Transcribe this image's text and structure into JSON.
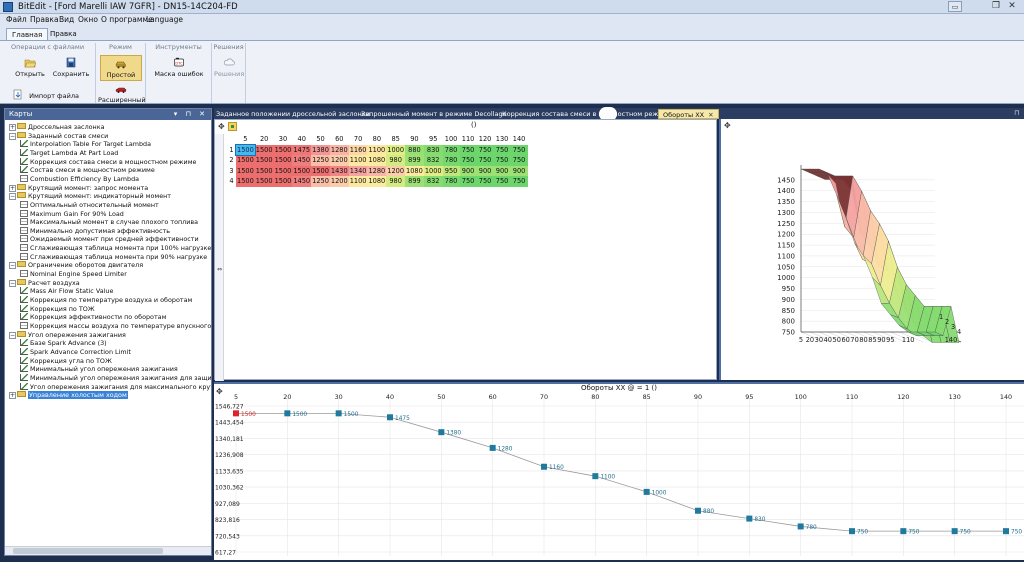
{
  "window": {
    "title": "BitEdit - [Ford Marelli IAW 7GFR] - DN15-14C204-FD",
    "restore_glyph": "❐",
    "close_glyph": "✕",
    "min_glyph": "▭"
  },
  "menu": [
    "Файл",
    "Правка",
    "Вид",
    "Окно",
    "О программе",
    "Language"
  ],
  "ribbon_tabs": [
    {
      "label": "Главная",
      "active": true
    },
    {
      "label": "Правка",
      "active": false
    }
  ],
  "ribbon": {
    "file_group": {
      "label": "Операции с файлами",
      "open": "Открыть",
      "save": "Сохранить",
      "import": "Импорт файла"
    },
    "mode_group": {
      "label": "Режим",
      "simple": "Простой",
      "advanced": "Расширенный"
    },
    "tools_group": {
      "label": "Инструменты",
      "error_mask": "Маска ошибок",
      "dtc_text": "DTC"
    },
    "solutions_group": {
      "label": "Решения",
      "solutions": "Решения"
    }
  },
  "left_panel": {
    "title": "Карты",
    "controls": "▾ ⊓ ✕"
  },
  "tree": [
    {
      "level": 0,
      "type": "folder",
      "label": "Дроссельная заслонка"
    },
    {
      "level": 0,
      "type": "folder",
      "expanded": true,
      "label": "Заданный состав смеси"
    },
    {
      "level": 1,
      "type": "graph",
      "label": "Interpolation Table For Target Lambda"
    },
    {
      "level": 1,
      "type": "graph",
      "label": "Target Lambda At Part Load"
    },
    {
      "level": 1,
      "type": "graph",
      "label": "Коррекция состава смеси в мощностном режиме"
    },
    {
      "level": 1,
      "type": "graph",
      "label": "Состав смеси в мощностном режиме"
    },
    {
      "level": 1,
      "type": "table",
      "label": "Combustion Efficiency By Lambda"
    },
    {
      "level": 0,
      "type": "folder",
      "label": "Крутящий момент: запрос момента"
    },
    {
      "level": 0,
      "type": "folder",
      "expanded": true,
      "label": "Крутящий момент: индикаторный момент"
    },
    {
      "level": 1,
      "type": "table",
      "label": "Оптимальный относительный момент"
    },
    {
      "level": 1,
      "type": "table",
      "label": "Maximum Gain For 90% Load"
    },
    {
      "level": 1,
      "type": "table",
      "label": "Максимальный момент в случае плохого топлива"
    },
    {
      "level": 1,
      "type": "table",
      "label": "Минимально допустимая эффективность"
    },
    {
      "level": 1,
      "type": "table",
      "label": "Ожидаемый момент при средней эффективности"
    },
    {
      "level": 1,
      "type": "table",
      "label": "Сглаживающая таблица момента при 100% нагрузке"
    },
    {
      "level": 1,
      "type": "table",
      "label": "Сглаживающая таблица момента при 90% нагрузке"
    },
    {
      "level": 0,
      "type": "folder",
      "expanded": true,
      "label": "Ограничение оборотов двигателя"
    },
    {
      "level": 1,
      "type": "table",
      "label": "Nominal Engine Speed Limiter"
    },
    {
      "level": 0,
      "type": "folder",
      "expanded": true,
      "label": "Расчет воздуха"
    },
    {
      "level": 1,
      "type": "graph",
      "label": "Mass Air Flow Static Value"
    },
    {
      "level": 1,
      "type": "graph",
      "label": "Коррекция по температуре воздуха и оборотам"
    },
    {
      "level": 1,
      "type": "graph",
      "label": "Коррекция по ТОЖ"
    },
    {
      "level": 1,
      "type": "graph",
      "label": "Коррекция эффективности по оборотам"
    },
    {
      "level": 1,
      "type": "table",
      "label": "Коррекция массы воздуха по температуре впускного возду"
    },
    {
      "level": 0,
      "type": "folder",
      "expanded": true,
      "label": "Угол опережения зажигания"
    },
    {
      "level": 1,
      "type": "graph",
      "label": "Базе Spark Advance (3)"
    },
    {
      "level": 1,
      "type": "graph",
      "label": "Spark Advance Correction Limit"
    },
    {
      "level": 1,
      "type": "graph",
      "label": "Коррекция угла по ТОЖ"
    },
    {
      "level": 1,
      "type": "graph",
      "label": "Минимальный угол опережения зажигания"
    },
    {
      "level": 1,
      "type": "graph",
      "label": "Минимальный угол опережения зажигания для защиты дв"
    },
    {
      "level": 1,
      "type": "graph",
      "label": "Угол опережения зажигания для максимального крутящего"
    },
    {
      "level": 0,
      "type": "folder",
      "selected": true,
      "label": "Управление холостым ходом"
    }
  ],
  "doc_tabs": [
    {
      "label": "Заданное положении дроссельной заслонки"
    },
    {
      "label": "Запрошенный момент в режиме Decollage"
    },
    {
      "label": "Коррекция состава смеси в мощностном режиме"
    },
    {
      "label": "Обороты ХХ",
      "active": true
    }
  ],
  "table": {
    "paren_label": "()",
    "columns": [
      "5",
      "20",
      "30",
      "40",
      "50",
      "60",
      "70",
      "80",
      "85",
      "90",
      "95",
      "100",
      "110",
      "120",
      "130",
      "140"
    ],
    "rows": [
      {
        "label": "1",
        "values": [
          1500,
          1500,
          1500,
          1475,
          1380,
          1280,
          1160,
          1100,
          1000,
          880,
          830,
          780,
          750,
          750,
          750,
          750
        ]
      },
      {
        "label": "2",
        "values": [
          1500,
          1500,
          1500,
          1450,
          1250,
          1200,
          1100,
          1080,
          980,
          899,
          832,
          780,
          750,
          750,
          750,
          750
        ]
      },
      {
        "label": "3",
        "values": [
          1500,
          1500,
          1500,
          1500,
          1500,
          1430,
          1340,
          1280,
          1200,
          1080,
          1000,
          950,
          900,
          900,
          900,
          900
        ]
      },
      {
        "label": "4",
        "values": [
          1500,
          1500,
          1500,
          1450,
          1250,
          1200,
          1100,
          1080,
          980,
          899,
          832,
          780,
          750,
          750,
          750,
          750
        ]
      }
    ]
  },
  "chart_data": [
    {
      "type": "surface3d",
      "y_ticks": [
        "1450",
        "1400",
        "1350",
        "1300",
        "1250",
        "1200",
        "1150",
        "1100",
        "1050",
        "1000",
        "950",
        "900",
        "850",
        "800",
        "750"
      ],
      "x_ticks": [
        "5",
        "20",
        "30",
        "40",
        "50",
        "60",
        "70",
        "80",
        "85",
        "90",
        "95",
        "110"
      ],
      "x_last_tick": "140",
      "z_ticks": [
        "1",
        "2",
        "3",
        "4"
      ],
      "ylim": [
        750,
        1500
      ],
      "series": [
        {
          "name": "1",
          "values": [
            1500,
            1500,
            1500,
            1475,
            1380,
            1280,
            1160,
            1100,
            1000,
            880,
            830,
            780,
            750,
            750,
            750,
            750
          ]
        },
        {
          "name": "2",
          "values": [
            1500,
            1500,
            1500,
            1450,
            1250,
            1200,
            1100,
            1080,
            980,
            899,
            832,
            780,
            750,
            750,
            750,
            750
          ]
        },
        {
          "name": "3",
          "values": [
            1500,
            1500,
            1500,
            1500,
            1500,
            1430,
            1340,
            1280,
            1200,
            1080,
            1000,
            950,
            900,
            900,
            900,
            900
          ]
        },
        {
          "name": "4",
          "values": [
            1500,
            1500,
            1500,
            1450,
            1250,
            1200,
            1100,
            1080,
            980,
            899,
            832,
            780,
            750,
            750,
            750,
            750
          ]
        }
      ]
    },
    {
      "type": "line",
      "title": "Обороты ХХ  @  = 1 ()",
      "x": [
        5,
        20,
        30,
        40,
        50,
        60,
        70,
        80,
        85,
        90,
        95,
        100,
        110,
        120,
        130,
        140
      ],
      "x_ticks": [
        "5",
        "20",
        "30",
        "40",
        "50",
        "60",
        "70",
        "80",
        "85",
        "90",
        "95",
        "100",
        "110",
        "120",
        "130",
        "140"
      ],
      "values": [
        1500,
        1500,
        1500,
        1475,
        1380,
        1280,
        1160,
        1100,
        1000,
        880,
        830,
        780,
        750,
        750,
        750,
        750
      ],
      "highlighted_index": 0,
      "y_ticks": [
        "1546,727",
        "1443,454",
        "1340,181",
        "1236,908",
        "1133,635",
        "1030,362",
        "927,089",
        "823,816",
        "720,543",
        "617,27"
      ],
      "ylim": [
        617.27,
        1546.727
      ],
      "grid": true
    }
  ]
}
